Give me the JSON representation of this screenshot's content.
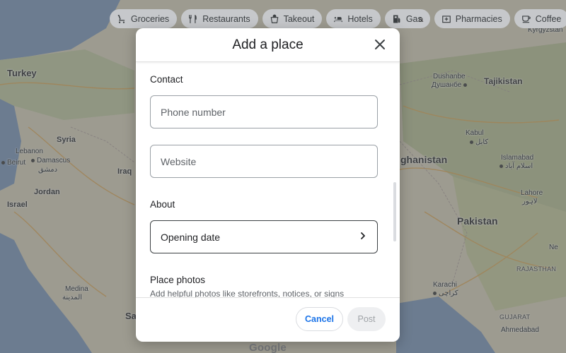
{
  "chips": [
    {
      "label": "Groceries",
      "icon": "cart-icon"
    },
    {
      "label": "Restaurants",
      "icon": "fork-knife-icon"
    },
    {
      "label": "Takeout",
      "icon": "takeout-icon"
    },
    {
      "label": "Hotels",
      "icon": "bed-icon"
    },
    {
      "label": "Gas",
      "icon": "gas-pump-icon"
    },
    {
      "label": "Pharmacies",
      "icon": "pharmacy-icon"
    },
    {
      "label": "Coffee",
      "icon": "coffee-icon"
    }
  ],
  "map": {
    "countries": [
      "Turkey",
      "Syria",
      "Iraq",
      "Jordan",
      "Israel",
      "Lebanon",
      "Tajikistan",
      "Pakistan",
      "ghanistan",
      "Kyrgyzstan"
    ],
    "cities": [
      "Beirut",
      "Damascus",
      "دمشق",
      "Medina",
      "المدينة",
      "Dushanbe",
      "Душанбе",
      "Kabul",
      "کابل",
      "Islamabad",
      "اسلام آباد",
      "Lahore",
      "لاہور",
      "Karachi",
      "کراچی",
      "Ahmedabad",
      "Ne",
      "Sa"
    ],
    "regions": [
      "RAJASTHAN",
      "GUJARAT"
    ],
    "stray_letter": "a"
  },
  "dialog": {
    "title": "Add a place",
    "contact_heading": "Contact",
    "phone_placeholder": "Phone number",
    "website_placeholder": "Website",
    "about_heading": "About",
    "opening_date_label": "Opening date",
    "photos_heading": "Place photos",
    "photos_hint": "Add helpful photos like storefronts, notices, or signs",
    "cancel_label": "Cancel",
    "post_label": "Post"
  },
  "colors": {
    "accent": "#1a73e8",
    "scrim": "#3c4043",
    "chip_bg": "#c6c8cb"
  },
  "footer": {
    "logo": "Google"
  }
}
